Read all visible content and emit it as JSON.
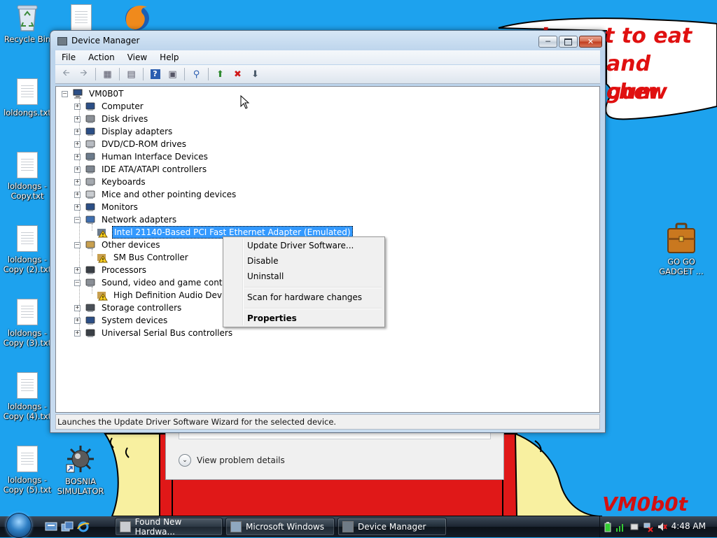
{
  "wallpaper": {
    "lines": [
      "...I want to eat shit",
      "and chew",
      "gum"
    ],
    "signature": "VM0b0t"
  },
  "desktop_icons": [
    {
      "label": "Recycle Bin",
      "icon": "recycle-bin-icon"
    },
    {
      "label": "loldongs.txt",
      "icon": "text-file-icon"
    },
    {
      "label": "loldongs - Copy.txt",
      "icon": "text-file-icon"
    },
    {
      "label": "loldongs - Copy (2).txt",
      "icon": "text-file-icon"
    },
    {
      "label": "loldongs - Copy (3).txt",
      "icon": "text-file-icon"
    },
    {
      "label": "loldongs - Copy (4).txt",
      "icon": "text-file-icon"
    },
    {
      "label": "loldongs - Copy (5).txt",
      "icon": "text-file-icon"
    },
    {
      "label": "BOSNIA SIMULATOR",
      "icon": "mine-shortcut-icon"
    },
    {
      "label": "GO GO GADGET ...",
      "icon": "briefcase-icon"
    }
  ],
  "background_dialog": {
    "details_label": "View problem details"
  },
  "window": {
    "title": "Device Manager",
    "menu": [
      "File",
      "Action",
      "View",
      "Help"
    ],
    "toolbar_icons": [
      "back-arrow-icon",
      "forward-arrow-icon",
      "show-hide-tree-icon",
      "properties-icon",
      "help-icon",
      "action-pane-icon",
      "scan-hardware-icon",
      "update-driver-icon",
      "uninstall-icon",
      "disable-icon"
    ],
    "status": "Launches the Update Driver Software Wizard for the selected device."
  },
  "tree": {
    "root": "VM0B0T",
    "items": [
      {
        "label": "Computer",
        "icon": "computer-icon",
        "expanded": false
      },
      {
        "label": "Disk drives",
        "icon": "disk-drive-icon",
        "expanded": false
      },
      {
        "label": "Display adapters",
        "icon": "display-adapter-icon",
        "expanded": false
      },
      {
        "label": "DVD/CD-ROM drives",
        "icon": "dvd-drive-icon",
        "expanded": false
      },
      {
        "label": "Human Interface Devices",
        "icon": "hid-icon",
        "expanded": false
      },
      {
        "label": "IDE ATA/ATAPI controllers",
        "icon": "ide-controller-icon",
        "expanded": false
      },
      {
        "label": "Keyboards",
        "icon": "keyboard-icon",
        "expanded": false
      },
      {
        "label": "Mice and other pointing devices",
        "icon": "mouse-icon",
        "expanded": false
      },
      {
        "label": "Monitors",
        "icon": "monitor-icon",
        "expanded": false
      },
      {
        "label": "Network adapters",
        "icon": "network-adapter-icon",
        "expanded": true,
        "children": [
          {
            "label": "Intel 21140-Based PCI Fast Ethernet Adapter (Emulated)",
            "icon": "warning-device-icon",
            "selected": true
          }
        ]
      },
      {
        "label": "Other devices",
        "icon": "other-devices-icon",
        "expanded": true,
        "children": [
          {
            "label": "SM Bus Controller",
            "icon": "warning-device-icon"
          }
        ]
      },
      {
        "label": "Processors",
        "icon": "processor-icon",
        "expanded": false
      },
      {
        "label": "Sound, video and game controllers",
        "icon": "speaker-icon",
        "expanded": true,
        "children": [
          {
            "label": "High Definition Audio Device",
            "icon": "warning-device-icon"
          }
        ]
      },
      {
        "label": "Storage controllers",
        "icon": "storage-controller-icon",
        "expanded": false
      },
      {
        "label": "System devices",
        "icon": "system-devices-icon",
        "expanded": false
      },
      {
        "label": "Universal Serial Bus controllers",
        "icon": "usb-icon",
        "expanded": false
      }
    ]
  },
  "context_menu": {
    "items": [
      "Update Driver Software...",
      "Disable",
      "Uninstall",
      "Scan for hardware changes",
      "Properties"
    ]
  },
  "taskbar": {
    "buttons": [
      "Found New Hardwa...",
      "Microsoft Windows",
      "Device Manager"
    ],
    "clock": "4:48 AM"
  },
  "colors": {
    "desktop": "#1da2ee",
    "selection": "#3399ff",
    "wallpaper_text": "#e01010"
  }
}
